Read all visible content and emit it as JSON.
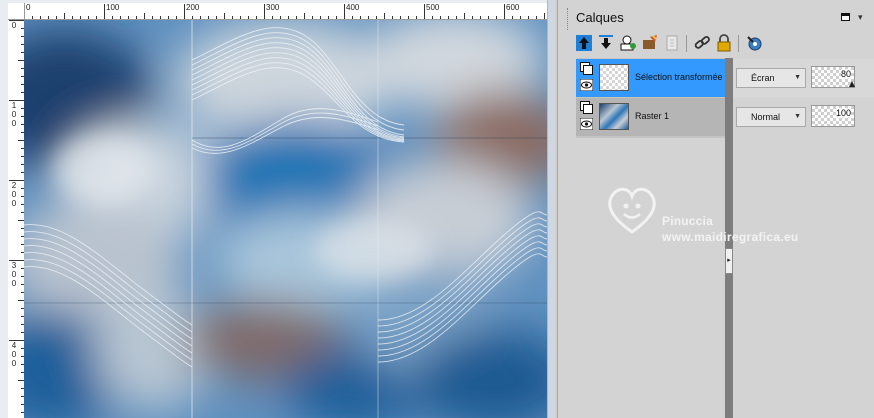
{
  "ruler": {
    "top_labels": [
      "0",
      "100",
      "200",
      "300",
      "400",
      "500",
      "600"
    ],
    "left_labels": [
      "0",
      "1 0 0",
      "2 0 0",
      "3 0 0",
      "4 0 0"
    ]
  },
  "palette": {
    "title": "Calques",
    "toolbar": {
      "icons": [
        "new-raster-layer-icon",
        "new-vector-layer-icon",
        "new-mask-layer-icon",
        "new-adjustment-layer-icon",
        "delete-layer-icon",
        "link-layer-icon",
        "lock-transparency-icon",
        "visibility-toggle-icon"
      ]
    },
    "layers": [
      {
        "name": "Sélection transformée",
        "blend_mode": "Écran",
        "opacity": "80",
        "selected": true
      },
      {
        "name": "Raster 1",
        "blend_mode": "Normal",
        "opacity": "100",
        "selected": false
      }
    ],
    "accent_color": "#3399ff"
  },
  "watermark": {
    "name": "Pinuccia",
    "url": "www.maidiregrafica.eu"
  }
}
